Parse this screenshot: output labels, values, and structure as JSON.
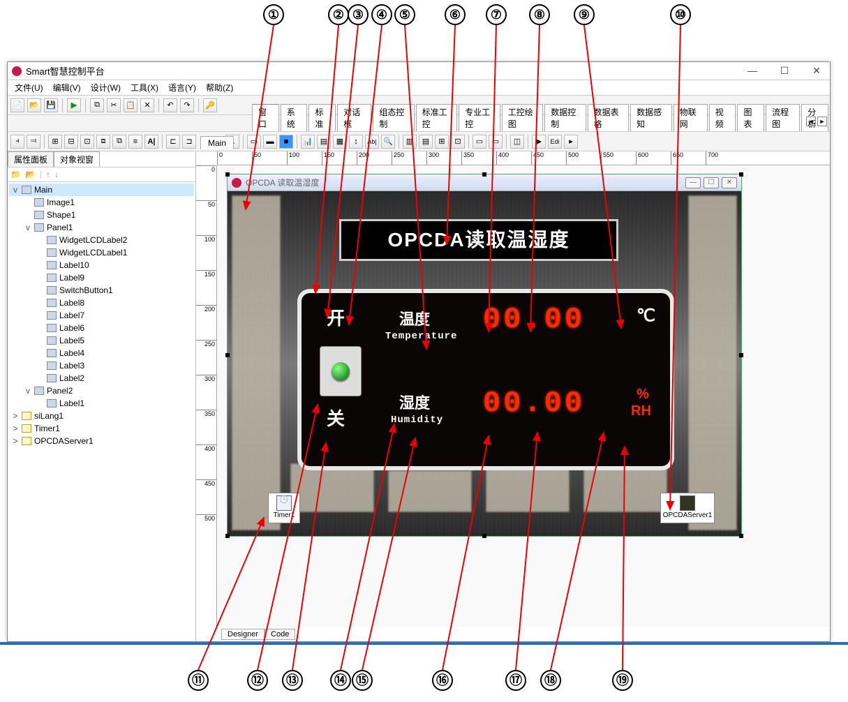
{
  "callouts_top": [
    "①",
    "②",
    "③",
    "④",
    "⑤",
    "⑥",
    "⑦",
    "⑧",
    "⑨",
    "⑩"
  ],
  "callouts_bottom": [
    "⑪",
    "⑫",
    "⑬",
    "⑭",
    "⑮",
    "⑯",
    "⑰",
    "⑱",
    "⑲"
  ],
  "app": {
    "title": "Smart智慧控制平台",
    "win_min": "—",
    "win_max": "☐",
    "win_close": "✕"
  },
  "menu": [
    "文件(U)",
    "编辑(V)",
    "设计(W)",
    "工具(X)",
    "语言(Y)",
    "帮助(Z)"
  ],
  "tabs_top": [
    "窗口",
    "系统",
    "标准",
    "对话框",
    "组态控制",
    "标准工控",
    "专业工控",
    "工控绘图",
    "数据控制",
    "数据表格",
    "数据感知",
    "物联网",
    "视频",
    "图表",
    "流程图",
    "分析"
  ],
  "left_tabs": {
    "prop": "属性面板",
    "obj": "对象视窗"
  },
  "tree": [
    {
      "lvl": 0,
      "exp": "v",
      "label": "Main",
      "sel": true
    },
    {
      "lvl": 1,
      "exp": "",
      "label": "Image1"
    },
    {
      "lvl": 1,
      "exp": "",
      "label": "Shape1"
    },
    {
      "lvl": 1,
      "exp": "v",
      "label": "Panel1"
    },
    {
      "lvl": 2,
      "exp": "",
      "label": "WidgetLCDLabel2"
    },
    {
      "lvl": 2,
      "exp": "",
      "label": "WidgetLCDLabel1"
    },
    {
      "lvl": 2,
      "exp": "",
      "label": "Label10"
    },
    {
      "lvl": 2,
      "exp": "",
      "label": "Label9"
    },
    {
      "lvl": 2,
      "exp": "",
      "label": "SwitchButton1"
    },
    {
      "lvl": 2,
      "exp": "",
      "label": "Label8"
    },
    {
      "lvl": 2,
      "exp": "",
      "label": "Label7"
    },
    {
      "lvl": 2,
      "exp": "",
      "label": "Label6"
    },
    {
      "lvl": 2,
      "exp": "",
      "label": "Label5"
    },
    {
      "lvl": 2,
      "exp": "",
      "label": "Label4"
    },
    {
      "lvl": 2,
      "exp": "",
      "label": "Label3"
    },
    {
      "lvl": 2,
      "exp": "",
      "label": "Label2"
    },
    {
      "lvl": 1,
      "exp": "v",
      "label": "Panel2"
    },
    {
      "lvl": 2,
      "exp": "",
      "label": "Label1"
    },
    {
      "lvl": 0,
      "exp": ">",
      "label": "siLang1",
      "comp": true
    },
    {
      "lvl": 0,
      "exp": ">",
      "label": "Timer1",
      "comp": true
    },
    {
      "lvl": 0,
      "exp": ">",
      "label": "OPCDAServer1",
      "comp": true
    }
  ],
  "doc_tab": "Main",
  "ruler_h": [
    "0",
    "50",
    "100",
    "150",
    "200",
    "250",
    "300",
    "350",
    "400",
    "450",
    "500",
    "550",
    "600",
    "650",
    "700"
  ],
  "ruler_v": [
    "0",
    "50",
    "100",
    "150",
    "200",
    "250",
    "300",
    "350",
    "400",
    "450",
    "500"
  ],
  "form": {
    "title": "OPCDA 读取温湿度",
    "banner": "OPCDA读取温湿度",
    "on": "开",
    "off": "关",
    "temp_cn": "温度",
    "temp_en": "Temperature",
    "temp_val": "00.00",
    "temp_unit": "℃",
    "hum_cn": "湿度",
    "hum_en": "Humidity",
    "hum_val": "00.00",
    "hum_unit_pct": "%",
    "hum_unit_rh": "RH",
    "timer_name": "Timer1",
    "opc_name": "OPCDAServer1"
  },
  "bottom_tabs": {
    "designer": "Designer",
    "code": "Code"
  }
}
